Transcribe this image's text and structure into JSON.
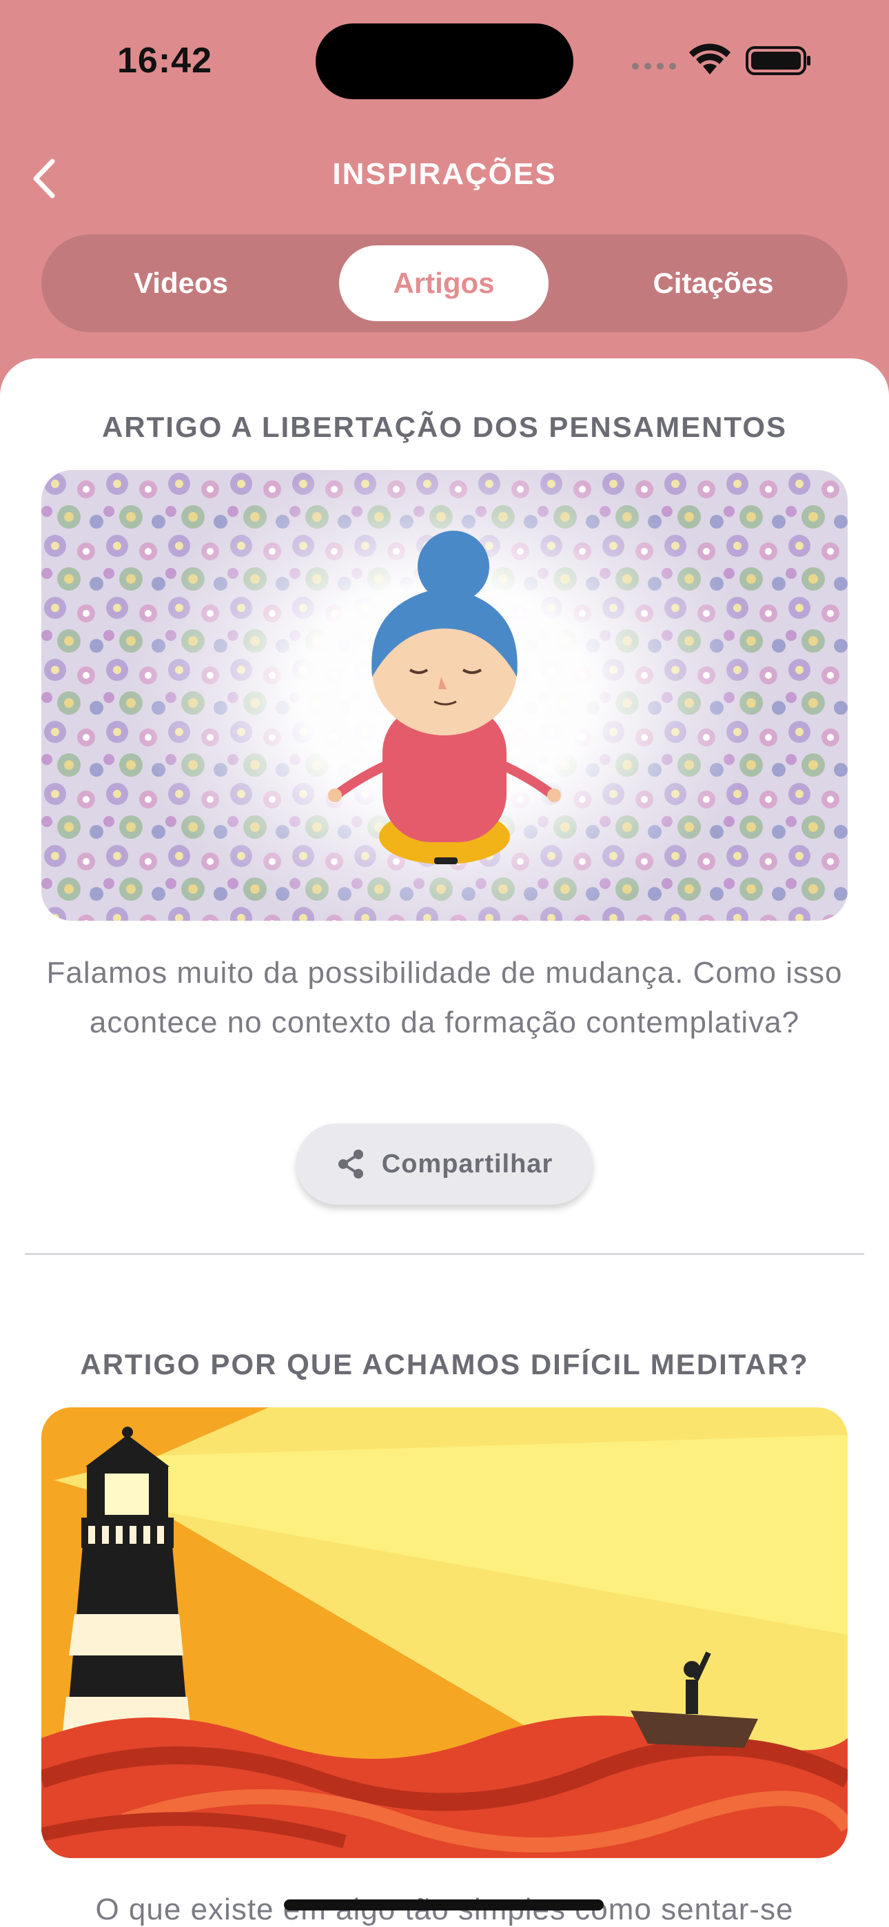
{
  "status": {
    "time": "16:42"
  },
  "header": {
    "title": "INSPIRAÇÕES"
  },
  "tabs": [
    {
      "label": "Videos",
      "selected": false
    },
    {
      "label": "Artigos",
      "selected": true
    },
    {
      "label": "Citações",
      "selected": false
    }
  ],
  "articles": [
    {
      "title": "ARTIGO A LIBERTAÇÃO DOS PENSAMENTOS",
      "excerpt": "Falamos muito da possibilidade de mudança. Como isso acontece no contexto da formação contemplativa?",
      "share_label": "Compartilhar"
    },
    {
      "title": "ARTIGO POR QUE ACHAMOS DIFÍCIL MEDITAR?",
      "excerpt": "O que existe em algo tão simples como sentar-se"
    }
  ],
  "colors": {
    "header_bg": "#de8b8e",
    "tab_track": "#c37a7d",
    "accent": "#e48d90"
  }
}
